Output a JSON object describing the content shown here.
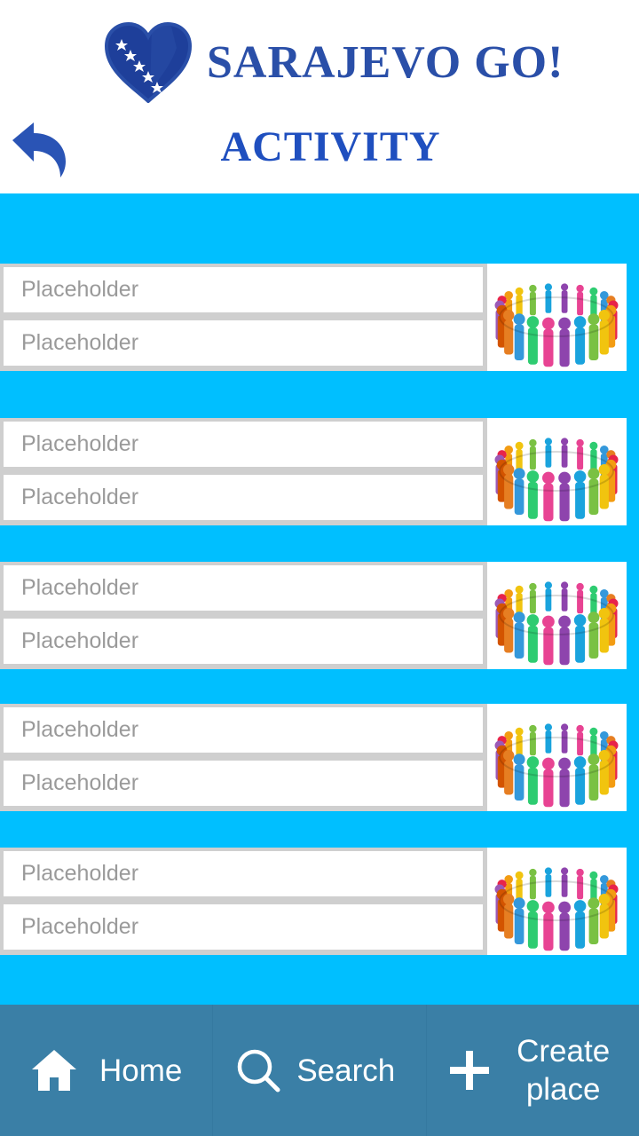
{
  "app": {
    "logo_text": "SARAJEVO GO!",
    "brand_color": "#2a4fa8",
    "accent_color": "#00bfff",
    "nav_color": "#3a7fa6"
  },
  "header": {
    "title": "ACTIVITY",
    "back_icon": "back-arrow-icon"
  },
  "list": {
    "items": [
      {
        "field1_placeholder": "Placeholder",
        "field2_placeholder": "Placeholder",
        "thumbnail": "group-circle-image"
      },
      {
        "field1_placeholder": "Placeholder",
        "field2_placeholder": "Placeholder",
        "thumbnail": "group-circle-image"
      },
      {
        "field1_placeholder": "Placeholder",
        "field2_placeholder": "Placeholder",
        "thumbnail": "group-circle-image"
      },
      {
        "field1_placeholder": "Placeholder",
        "field2_placeholder": "Placeholder",
        "thumbnail": "group-circle-image"
      },
      {
        "field1_placeholder": "Placeholder",
        "field2_placeholder": "Placeholder",
        "thumbnail": "group-circle-image"
      }
    ]
  },
  "bottom_nav": {
    "home": {
      "label": "Home",
      "icon": "home-icon"
    },
    "search": {
      "label": "Search",
      "icon": "search-icon"
    },
    "create": {
      "label": "Create place",
      "label_line1": "Create",
      "label_line2": "place",
      "icon": "plus-icon"
    }
  }
}
